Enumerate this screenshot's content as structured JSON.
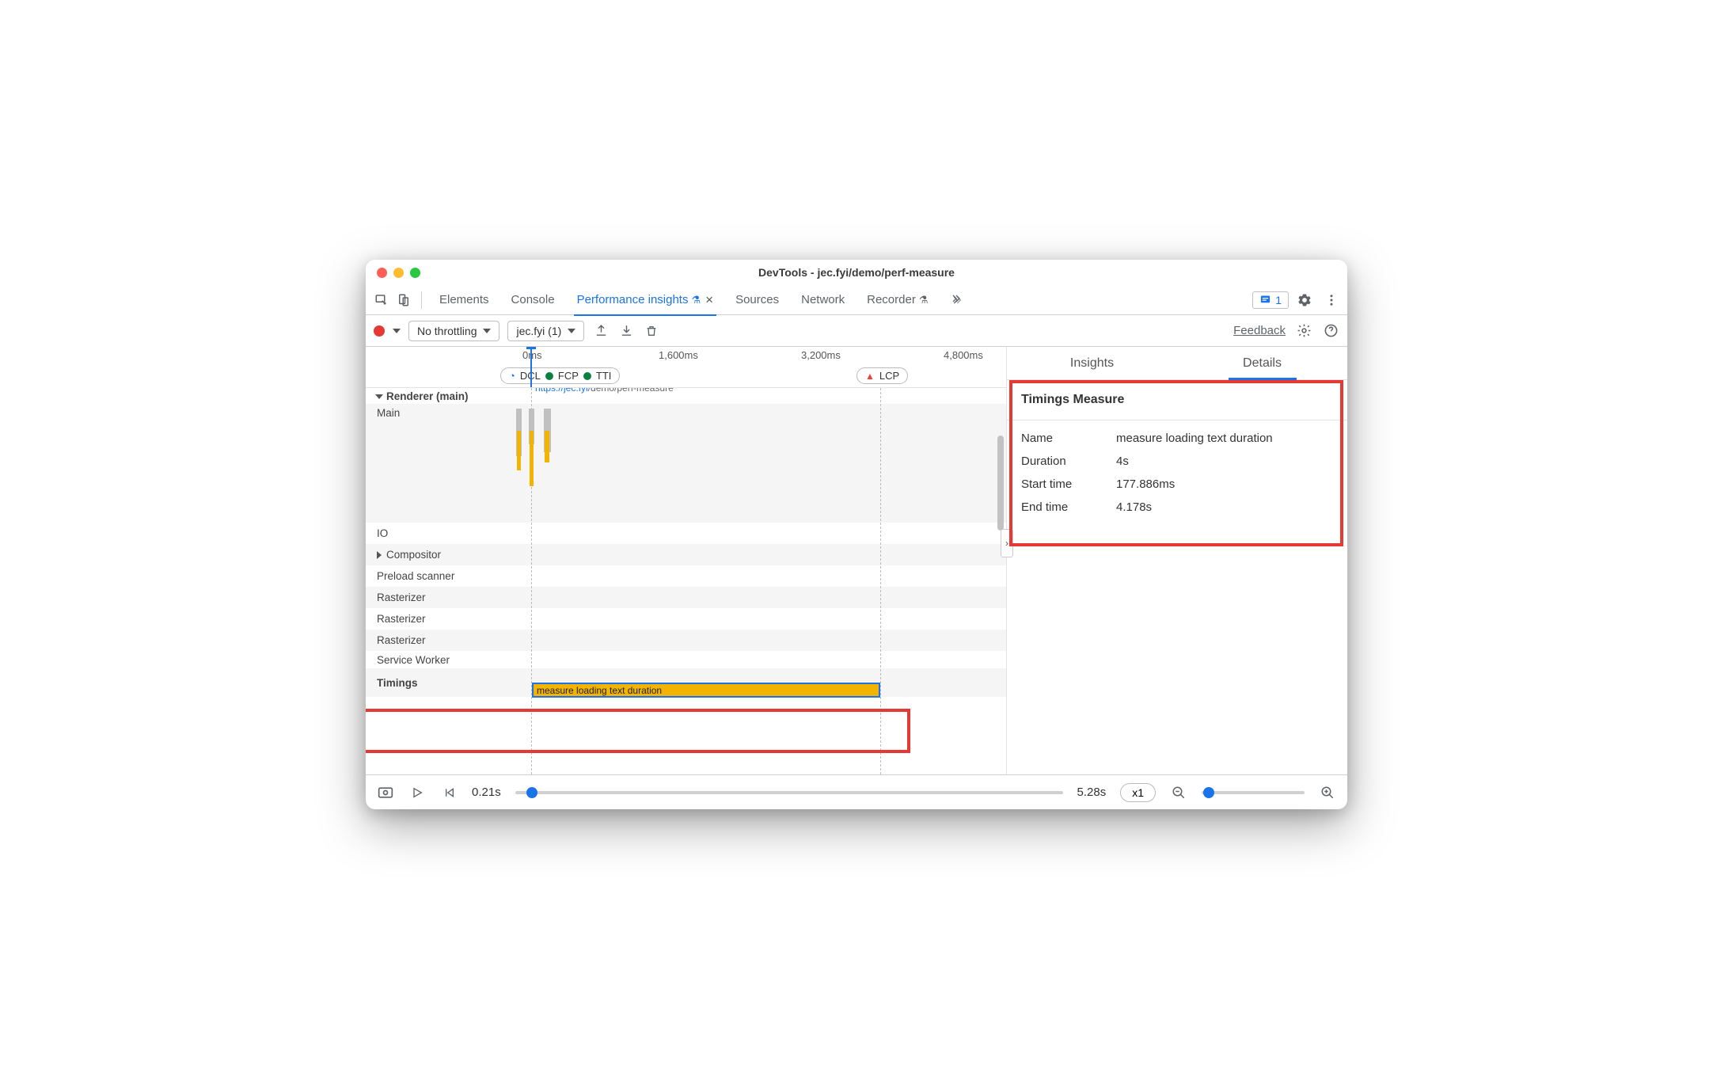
{
  "window": {
    "title": "DevTools - jec.fyi/demo/perf-measure"
  },
  "tabs": {
    "elements": "Elements",
    "console": "Console",
    "perf_insights": "Performance insights",
    "sources": "Sources",
    "network": "Network",
    "recorder": "Recorder",
    "issues_count": "1"
  },
  "toolbar": {
    "throttling": "No throttling",
    "profile": "jec.fyi (1)",
    "feedback": "Feedback"
  },
  "ruler": {
    "t0": "0ms",
    "t1": "1,600ms",
    "t2": "3,200ms",
    "t3": "4,800ms",
    "dcl": "DCL",
    "fcp": "FCP",
    "tti": "TTI",
    "lcp": "LCP"
  },
  "tracks": {
    "renderer": "Renderer (main)",
    "main": "Main",
    "io": "IO",
    "compositor": "Compositor",
    "preload": "Preload scanner",
    "rasterizer": "Rasterizer",
    "service_worker": "Service Worker",
    "timings": "Timings",
    "url_prefix": "https://jec.fyi/",
    "url_rest": "demo/perf-measure",
    "measure_label": "measure loading text duration"
  },
  "side": {
    "insights": "Insights",
    "details": "Details",
    "panel_title": "Timings Measure",
    "rows": {
      "name_k": "Name",
      "name_v": "measure loading text duration",
      "duration_k": "Duration",
      "duration_v": "4s",
      "start_k": "Start time",
      "start_v": "177.886ms",
      "end_k": "End time",
      "end_v": "4.178s"
    }
  },
  "footer": {
    "start": "0.21s",
    "end": "5.28s",
    "speed": "x1"
  }
}
